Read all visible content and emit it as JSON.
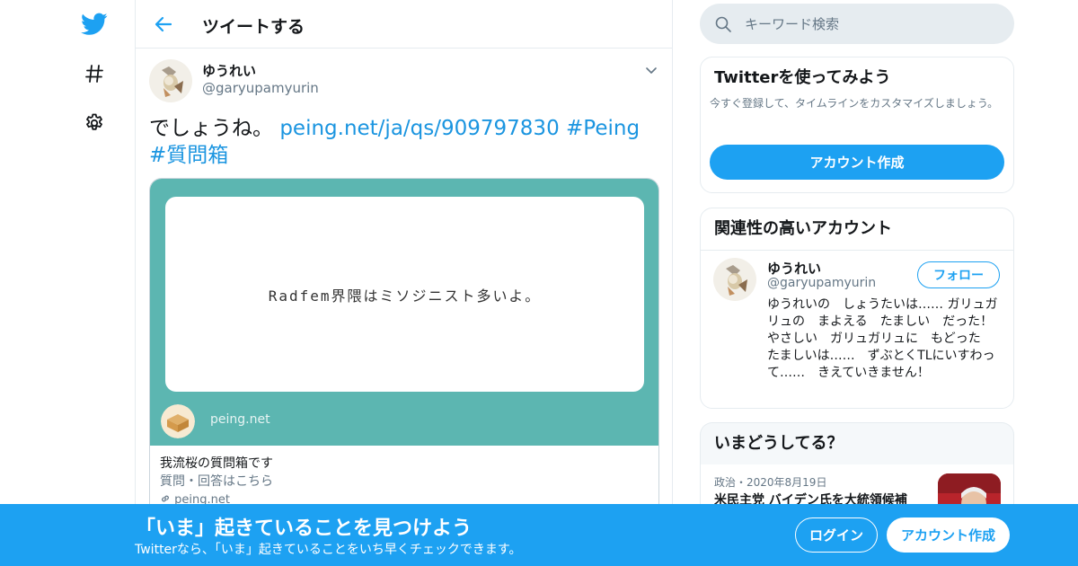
{
  "nav": {
    "icons": [
      "twitter-bird-icon",
      "hashtag-icon",
      "gear-icon"
    ]
  },
  "header": {
    "title": "ツイートする"
  },
  "tweet": {
    "author": {
      "name": "ゆうれい",
      "handle": "@garyupamyurin"
    },
    "text_plain": "でしょうね。",
    "text_link": "peing.net/ja/qs/909797830",
    "hashtag_1": "#Peing",
    "hashtag_2": "#質問箱",
    "card": {
      "question": "Radfem界隈はミソジニスト多いよ。",
      "logo_text": "peing.net",
      "title": "我流桜の質問箱です",
      "description": "質問・回答はこちら",
      "domain": "peing.net"
    }
  },
  "search": {
    "placeholder": "キーワード検索"
  },
  "signup_panel": {
    "title": "Twitterを使ってみよう",
    "description": "今すぐ登録して、タイムラインをカスタマイズしましょう。",
    "button": "アカウント作成"
  },
  "related_panel": {
    "title": "関連性の高いアカウント",
    "account": {
      "name": "ゆうれい",
      "handle": "@garyupamyurin",
      "follow_label": "フォロー",
      "bio": "ゆうれいの　しょうたいは…… ガリュガリュの　まよえる　たましい　だった！ やさしい　ガリュガリュに　もどった　たましいは……　ずぶとくTLにいすわって……　きえていきません！"
    }
  },
  "trends_panel": {
    "title": "いまどうしてる？",
    "item": {
      "meta": "政治・2020年8月19日",
      "title": "米民主党 バイデン氏を大統領候補"
    }
  },
  "bottom_bar": {
    "title": "「いま」起きていることを見つけよう",
    "subtitle": "Twitterなら、「いま」起きていることをいち早くチェックできます。",
    "login_label": "ログイン",
    "signup_label": "アカウント作成"
  },
  "colors": {
    "accent": "#1da1f2",
    "link": "#1b95e0",
    "card_bg": "#5cb6b1",
    "muted_text": "#657786",
    "border": "#e6ecf0"
  }
}
